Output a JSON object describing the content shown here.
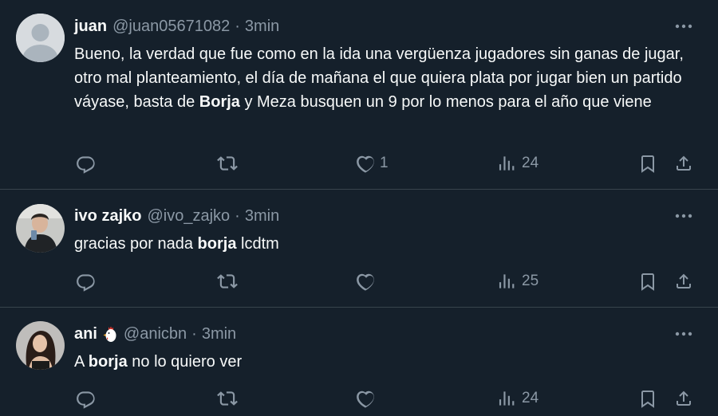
{
  "tweets": [
    {
      "name": "juan",
      "handle": "@juan05671082",
      "dot": "·",
      "time": "3min",
      "text": [
        {
          "t": "Bueno, la verdad que fue como en la ida una vergüenza jugadores sin ganas de jugar, otro mal planteamiento, el día de mañana el que quiera plata por jugar bien un partido váyase, basta de ",
          "b": false
        },
        {
          "t": "Borja",
          "b": true
        },
        {
          "t": " y Meza busquen un 9 por lo menos para el año que viene",
          "b": false
        }
      ],
      "likes": "1",
      "views": "24"
    },
    {
      "name": "ivo zajko",
      "handle": "@ivo_zajko",
      "dot": "·",
      "time": "3min",
      "text": [
        {
          "t": "gracias por nada ",
          "b": false
        },
        {
          "t": "borja",
          "b": true
        },
        {
          "t": " lcdtm",
          "b": false
        }
      ],
      "likes": "",
      "views": "25"
    },
    {
      "name": "ani",
      "emoji": "chicken-emoji",
      "handle": "@anicbn",
      "dot": "·",
      "time": "3min",
      "text": [
        {
          "t": "A ",
          "b": false
        },
        {
          "t": "borja",
          "b": true
        },
        {
          "t": " no lo quiero ver",
          "b": false
        }
      ],
      "likes": "",
      "views": "24"
    }
  ],
  "icons": {
    "reply": "reply-icon",
    "retweet": "retweet-icon",
    "like": "heart-icon",
    "views": "views-icon",
    "bookmark": "bookmark-icon",
    "share": "share-icon",
    "more": "more-icon"
  },
  "colors": {
    "background": "#15202b",
    "text": "#f7f9f9",
    "secondary": "#8b98a5",
    "divider": "#38444d"
  }
}
